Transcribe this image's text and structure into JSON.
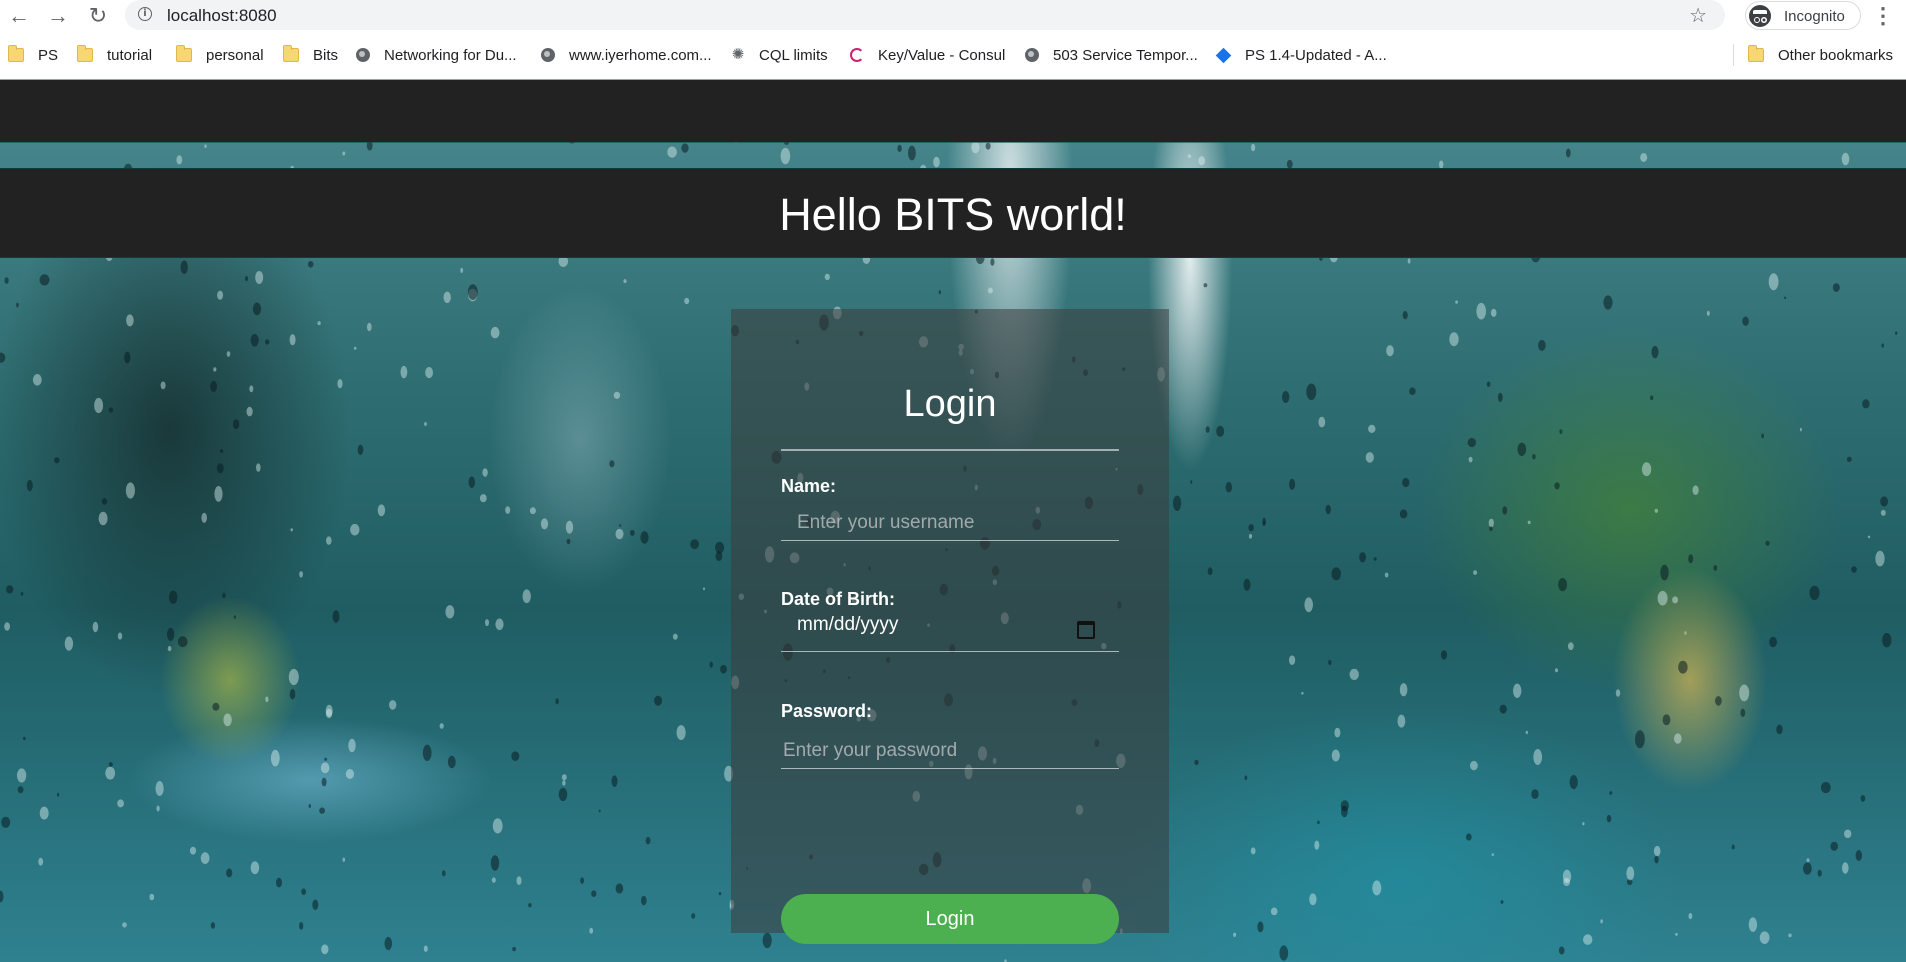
{
  "browser": {
    "url": "localhost:8080",
    "profile_label": "Incognito",
    "bookmarks": [
      {
        "label": "PS",
        "icon": "folder-icon"
      },
      {
        "label": "tutorial",
        "icon": "folder-icon"
      },
      {
        "label": "personal",
        "icon": "folder-icon"
      },
      {
        "label": "Bits",
        "icon": "folder-icon"
      },
      {
        "label": "Networking for Du...",
        "icon": "globe-icon"
      },
      {
        "label": "www.iyerhome.com...",
        "icon": "globe-icon"
      },
      {
        "label": "CQL limits",
        "icon": "cql-icon"
      },
      {
        "label": "Key/Value - Consul",
        "icon": "consul-icon"
      },
      {
        "label": "503 Service Tempor...",
        "icon": "globe-icon"
      },
      {
        "label": "PS 1.4-Updated - A...",
        "icon": "diamond-icon"
      }
    ],
    "other_bookmarks": "Other bookmarks"
  },
  "page": {
    "heading": "Hello BITS world!",
    "login": {
      "title": "Login",
      "name_label": "Name:",
      "name_placeholder": "Enter your username",
      "dob_label": "Date of Birth:",
      "dob_placeholder": "mm/dd/yyyy",
      "password_label": "Password:",
      "password_placeholder": "Enter your password",
      "button_label": "Login"
    }
  },
  "colors": {
    "button": "#4caf50",
    "band": "#222222"
  }
}
